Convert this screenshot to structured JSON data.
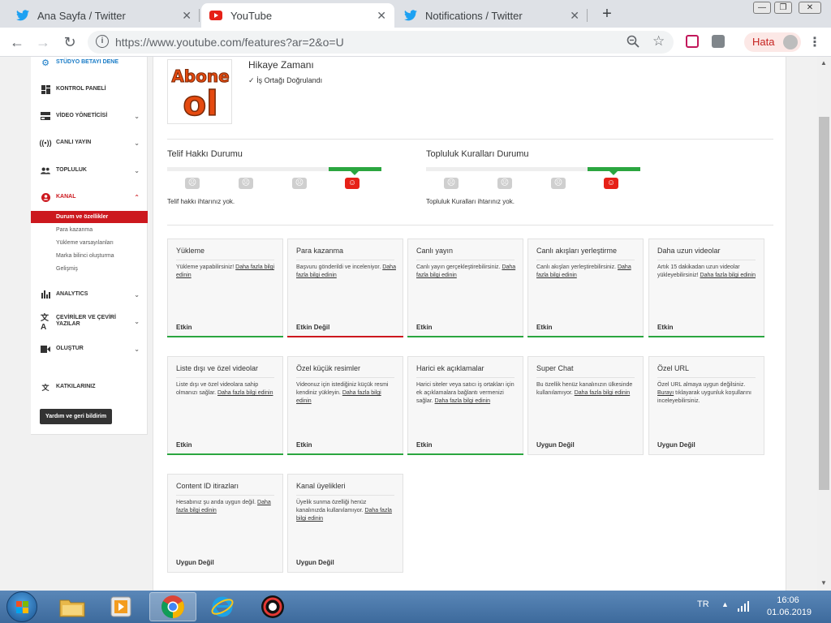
{
  "browser": {
    "tabs": [
      {
        "title": "Ana Sayfa / Twitter",
        "icon": "twitter-icon",
        "active": false
      },
      {
        "title": "YouTube",
        "icon": "youtube-icon",
        "active": true
      },
      {
        "title": "Notifications / Twitter",
        "icon": "twitter-icon",
        "active": false
      }
    ],
    "url": "https://www.youtube.com/features?ar=2&o=U",
    "profile_label": "Hata"
  },
  "sidebar": {
    "items": [
      {
        "label": "STÜDYO BETAYI DENE",
        "icon": "gear-icon",
        "chevron": false,
        "accent": true
      },
      {
        "label": "KONTROL PANELİ",
        "icon": "dashboard-icon",
        "chevron": false
      },
      {
        "label": "VİDEO YÖNETİCİSİ",
        "icon": "video-manager-icon",
        "chevron": true
      },
      {
        "label": "CANLI YAYIN",
        "icon": "live-icon",
        "chevron": true
      },
      {
        "label": "TOPLULUK",
        "icon": "community-icon",
        "chevron": true
      },
      {
        "label": "KANAL",
        "icon": "channel-icon",
        "chevron": true,
        "accent_red": true
      }
    ],
    "channel_sub": [
      {
        "label": "Durum ve özellikler",
        "selected": true
      },
      {
        "label": "Para kazanma",
        "selected": false
      },
      {
        "label": "Yükleme varsayılanları",
        "selected": false
      },
      {
        "label": "Marka bilinci oluşturma",
        "selected": false
      },
      {
        "label": "Gelişmiş",
        "selected": false
      }
    ],
    "items2": [
      {
        "label": "ANALYTICS",
        "icon": "analytics-icon",
        "chevron": true
      },
      {
        "label": "ÇEVİRİLER VE ÇEVİRİ YAZILAR",
        "icon": "translate-icon",
        "chevron": true
      },
      {
        "label": "OLUŞTUR",
        "icon": "create-icon",
        "chevron": true
      },
      {
        "label": "KATKILARINIZ",
        "icon": "contributions-icon",
        "chevron": false
      }
    ],
    "help_button": "Yardım ve geri bildirim"
  },
  "channel": {
    "name": "Hikaye Zamanı",
    "partner_status": "İş Ortağı Doğrulandı",
    "thumb_text_top": "Abone",
    "thumb_text_bottom": "ol"
  },
  "copyright": {
    "title": "Telif Hakkı Durumu",
    "description": "Telif hakkı ihtarınız yok.",
    "active_level": 3
  },
  "community": {
    "title": "Topluluk Kuralları Durumu",
    "description": "Topluluk Kuralları ihtarınız yok.",
    "active_level": 3
  },
  "features": [
    {
      "title": "Yükleme",
      "desc": "Yükleme yapabilirsiniz! ",
      "link": "Daha fazla bilgi edinin",
      "after": "",
      "status": "Etkin",
      "state": "ok"
    },
    {
      "title": "Para kazanma",
      "desc": "Başvuru gönderildi ve inceleniyor. ",
      "link": "Daha fazla bilgi edinin",
      "after": "",
      "status": "Etkin Değil",
      "state": "bad"
    },
    {
      "title": "Canlı yayın",
      "desc": "Canlı yayın gerçekleştirebilirsiniz. ",
      "link": "Daha fazla bilgi edinin",
      "after": "",
      "status": "Etkin",
      "state": "ok"
    },
    {
      "title": "Canlı akışları yerleştirme",
      "desc": "Canlı akışları yerleştirebilirsiniz. ",
      "link": "Daha fazla bilgi edinin",
      "after": "",
      "status": "Etkin",
      "state": "ok"
    },
    {
      "title": "Daha uzun videolar",
      "desc": "Artık 15 dakikadan uzun videolar yükleyebilirsiniz! ",
      "link": "Daha fazla bilgi edinin",
      "after": "",
      "status": "Etkin",
      "state": "ok"
    },
    {
      "title": "Liste dışı ve özel videolar",
      "desc": "Liste dışı ve özel videolara sahip olmanızı sağlar. ",
      "link": "Daha fazla bilgi edinin",
      "after": "",
      "status": "Etkin",
      "state": "ok"
    },
    {
      "title": "Özel küçük resimler",
      "desc": "Videonuz için istediğiniz küçük resmi kendiniz yükleyin. ",
      "link": "Daha fazla bilgi edinin",
      "after": "",
      "status": "Etkin",
      "state": "ok"
    },
    {
      "title": "Harici ek açıklamalar",
      "desc": "Harici siteler veya satıcı iş ortakları için ek açıklamalara bağlantı vermenizi sağlar. ",
      "link": "Daha fazla bilgi edinin",
      "after": "",
      "status": "Etkin",
      "state": "ok"
    },
    {
      "title": "Super Chat",
      "desc": "Bu özellik henüz kanalınızın ülkesinde kullanılamıyor. ",
      "link": "Daha fazla bilgi edinin",
      "after": "",
      "status": "Uygun Değil",
      "state": "none"
    },
    {
      "title": "Özel URL",
      "desc": "Özel URL almaya uygun değilsiniz. ",
      "link": "Burayı",
      "after": " tıklayarak uygunluk koşullarını inceleyebilirsiniz.",
      "status": "Uygun Değil",
      "state": "none"
    },
    {
      "title": "Content ID itirazları",
      "desc": "Hesabınız şu anda uygun değil. ",
      "link": "Daha fazla bilgi edinin",
      "after": "",
      "status": "Uygun Değil",
      "state": "none"
    },
    {
      "title": "Kanal üyelikleri",
      "desc": "Üyelik sunma özelliği henüz kanalınızda kullanılamıyor. ",
      "link": "Daha fazla bilgi edinin",
      "after": "",
      "status": "Uygun Değil",
      "state": "none"
    }
  ],
  "taskbar": {
    "language": "TR",
    "time": "16:06",
    "date": "01.06.2019",
    "apps": [
      "file-explorer-icon",
      "media-player-icon",
      "chrome-icon",
      "internet-explorer-icon",
      "screen-recorder-icon"
    ]
  },
  "colors": {
    "ok": "#2ba640",
    "bad": "#cc181e",
    "accent_blue": "#167ac6",
    "youtube_red": "#e62117"
  }
}
